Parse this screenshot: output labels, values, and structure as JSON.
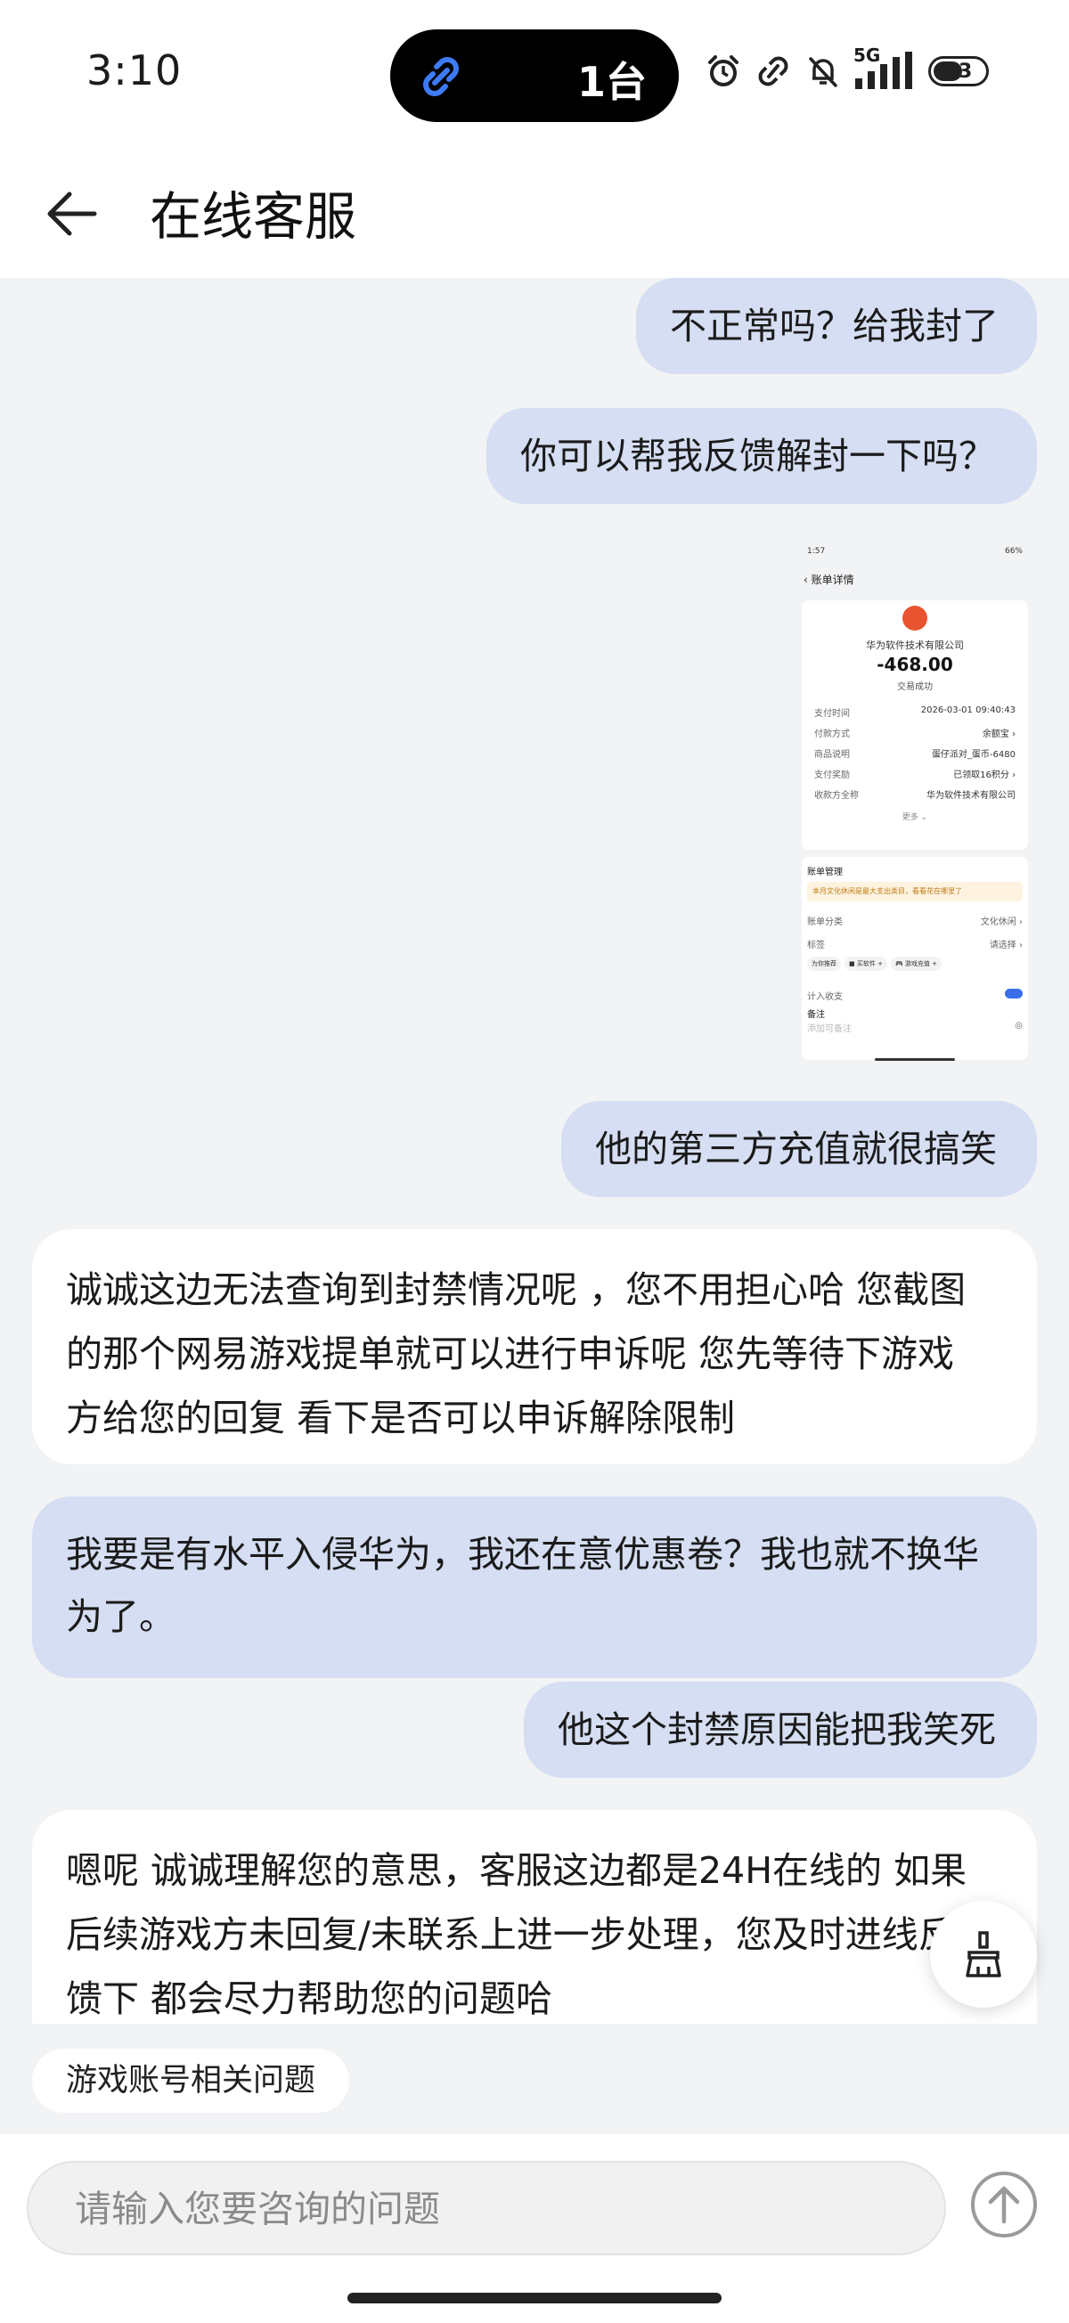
{
  "status_bar": {
    "time": "3:10",
    "island_text": "1台",
    "network": "5G",
    "battery": "53"
  },
  "header": {
    "title": "在线客服"
  },
  "messages": [
    {
      "role": "user",
      "text": "不正常吗？给我封了"
    },
    {
      "role": "user",
      "text": "你可以帮我反馈解封一下吗？"
    },
    {
      "role": "user",
      "type": "image"
    },
    {
      "role": "user",
      "text": "他的第三方充值就很搞笑"
    },
    {
      "role": "agent",
      "lines": [
        "诚诚这边无法查询到封禁情况呢 ，您不用担心哈 您截图",
        "的那个网易游戏提单就可以进行申诉呢 您先等待下游戏",
        "方给您的回复 看下是否可以申诉解除限制"
      ]
    },
    {
      "role": "user",
      "lines": [
        "我要是有水平入侵华为，我还在意优惠卷？我也就不换华",
        "为了。"
      ]
    },
    {
      "role": "user",
      "text": "他这个封禁原因能把我笑死"
    },
    {
      "role": "agent",
      "lines": [
        "嗯呢 诚诚理解您的意思，客服这边都是24H在线的 如果",
        "后续游戏方未回复/未联系上进一步处理，您及时进线反",
        "馈下 都会尽力帮助您的问题哈"
      ]
    }
  ],
  "receipt_image": {
    "time": "1:57",
    "battery": "66%",
    "title": "账单详情",
    "merchant": "华为软件技术有限公司",
    "amount": "-468.00",
    "status": "交易成功",
    "rows": [
      {
        "label": "支付时间",
        "value": "2026-03-01 09:40:43"
      },
      {
        "label": "付款方式",
        "value": "余额宝 ›"
      },
      {
        "label": "商品说明",
        "value": "蛋仔派对_蛋币-6480"
      },
      {
        "label": "支付奖励",
        "value": "已领取16积分 ›"
      },
      {
        "label": "收款方全称",
        "value": "华为软件技术有限公司"
      }
    ],
    "more": "更多 ⌄",
    "manage_title": "账单管理",
    "notice": "本月文化休闲是最大支出类目，看看花在哪里了",
    "category_label": "账单分类",
    "category_value": "文化休闲 ›",
    "tag_label": "标签",
    "tag_value": "请选择 ›",
    "tags": [
      "为你推荐",
      "■ 买软件 +",
      "🎮 游戏充值 +"
    ],
    "stats_label": "计入收支",
    "note_label": "备注",
    "note_placeholder": "添加可备注"
  },
  "quick_reply": "游戏账号相关问题",
  "composer": {
    "placeholder": "请输入您要咨询的问题"
  }
}
